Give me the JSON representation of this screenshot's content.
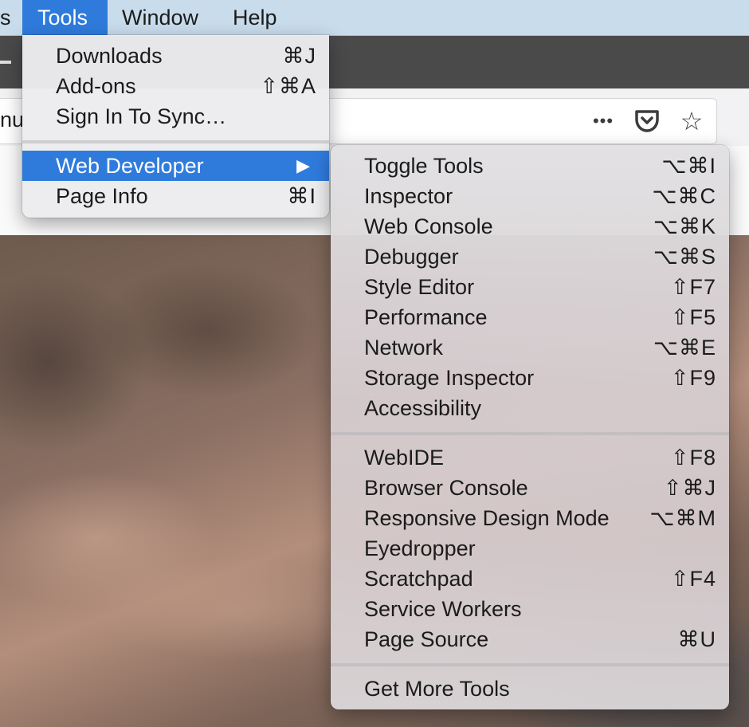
{
  "menubar": {
    "items": [
      {
        "label": "s"
      },
      {
        "label": "Tools"
      },
      {
        "label": "Window"
      },
      {
        "label": "Help"
      }
    ]
  },
  "browser": {
    "url_text": "nu",
    "more_icon": "•••",
    "pocket_icon": "pocket-icon",
    "bookmark_icon": "☆"
  },
  "tools_menu": {
    "items": [
      {
        "label": "Downloads",
        "shortcut": "⌘J"
      },
      {
        "label": "Add-ons",
        "shortcut": "⇧⌘A"
      },
      {
        "label": "Sign In To Sync…",
        "shortcut": ""
      },
      {
        "label": "Web Developer",
        "shortcut": "▶"
      },
      {
        "label": "Page Info",
        "shortcut": "⌘I"
      }
    ]
  },
  "webdev_menu": {
    "group1": [
      {
        "label": "Toggle Tools",
        "shortcut": "⌥⌘I"
      },
      {
        "label": "Inspector",
        "shortcut": "⌥⌘C"
      },
      {
        "label": "Web Console",
        "shortcut": "⌥⌘K"
      },
      {
        "label": "Debugger",
        "shortcut": "⌥⌘S"
      },
      {
        "label": "Style Editor",
        "shortcut": "⇧F7"
      },
      {
        "label": "Performance",
        "shortcut": "⇧F5"
      },
      {
        "label": "Network",
        "shortcut": "⌥⌘E"
      },
      {
        "label": "Storage Inspector",
        "shortcut": "⇧F9"
      },
      {
        "label": "Accessibility",
        "shortcut": ""
      }
    ],
    "group2": [
      {
        "label": "WebIDE",
        "shortcut": "⇧F8"
      },
      {
        "label": "Browser Console",
        "shortcut": "⇧⌘J"
      },
      {
        "label": "Responsive Design Mode",
        "shortcut": "⌥⌘M"
      },
      {
        "label": "Eyedropper",
        "shortcut": ""
      },
      {
        "label": "Scratchpad",
        "shortcut": "⇧F4"
      },
      {
        "label": "Service Workers",
        "shortcut": ""
      },
      {
        "label": "Page Source",
        "shortcut": "⌘U"
      }
    ],
    "group3": [
      {
        "label": "Get More Tools",
        "shortcut": ""
      }
    ]
  },
  "colors": {
    "highlight": "#2f7bdc",
    "menubar": "#c8dcec"
  }
}
